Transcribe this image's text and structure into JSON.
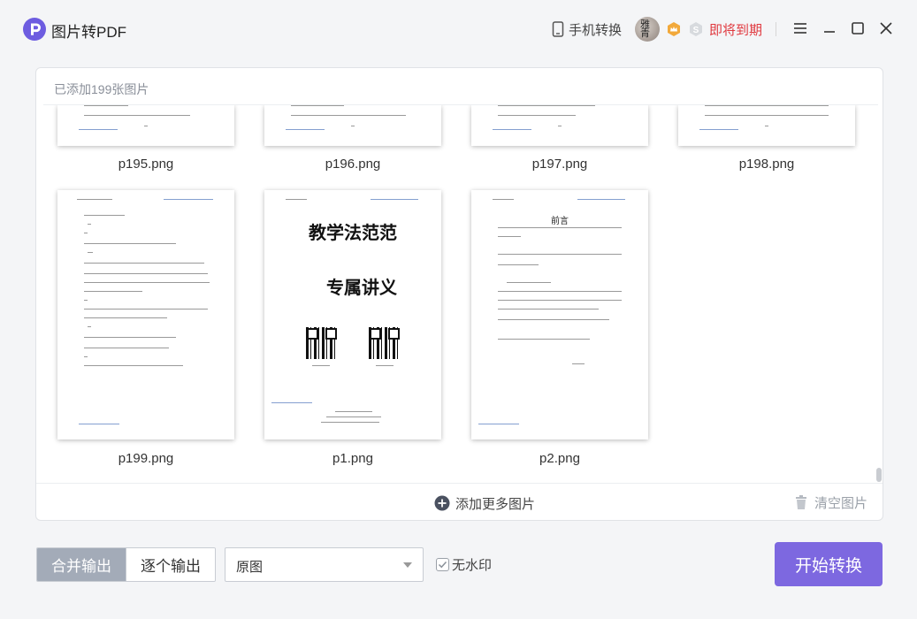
{
  "app": {
    "title": "图片转PDF"
  },
  "header": {
    "phone_label": "手机转换",
    "expire_label": "即将到期",
    "avatar_text": "雅\n青"
  },
  "panel": {
    "count_label": "已添加199张图片",
    "add_more_label": "添加更多图片",
    "clear_label": "清空图片"
  },
  "thumbnails": [
    {
      "name": "p195.png"
    },
    {
      "name": "p196.png"
    },
    {
      "name": "p197.png"
    },
    {
      "name": "p198.png"
    },
    {
      "name": "p199.png"
    },
    {
      "name": "p1.png",
      "title1": "教学法范范",
      "title2": "专属讲义"
    },
    {
      "name": "p2.png",
      "heading": "前言"
    }
  ],
  "bottom": {
    "merge_label": "合并输出",
    "single_label": "逐个输出",
    "size_value": "原图",
    "watermark_label": "无水印",
    "start_label": "开始转换"
  },
  "colors": {
    "accent": "#7d68e0",
    "expire": "#e0383e",
    "segment_active": "#a3abb8"
  }
}
